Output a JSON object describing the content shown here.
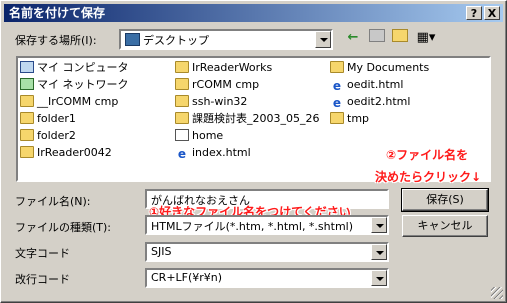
{
  "window": {
    "title": "名前を付けて保存",
    "help_label": "?",
    "close_label": "X"
  },
  "location": {
    "label": "保存する場所(I):",
    "value": "デスクトップ"
  },
  "toolbar": {
    "back_icon": "←",
    "view_icon": "▦▾"
  },
  "files": [
    {
      "name": "マイ コンピュータ",
      "icon": "pc"
    },
    {
      "name": "マイ ネットワーク",
      "icon": "net"
    },
    {
      "name": "__IrCOMM cmp",
      "icon": "folder"
    },
    {
      "name": "folder1",
      "icon": "folder"
    },
    {
      "name": "folder2",
      "icon": "folder"
    },
    {
      "name": "IrReader0042",
      "icon": "folder"
    },
    {
      "name": "IrReaderWorks",
      "icon": "folder"
    },
    {
      "name": "rCOMM cmp",
      "icon": "folder"
    },
    {
      "name": "ssh-win32",
      "icon": "folder"
    },
    {
      "name": "課題検討表_2003_05_26",
      "icon": "folder"
    },
    {
      "name": "home",
      "icon": "html"
    },
    {
      "name": "index.html",
      "icon": "ie"
    },
    {
      "name": "My Documents",
      "icon": "folder"
    },
    {
      "name": "oedit.html",
      "icon": "ie"
    },
    {
      "name": "oedit2.html",
      "icon": "ie"
    },
    {
      "name": "tmp",
      "icon": "folder"
    }
  ],
  "filename": {
    "label": "ファイル名(N):",
    "value": "がんばれなおえさん"
  },
  "filetype": {
    "label": "ファイルの種類(T):",
    "value": "HTMLファイル(*.htm, *.html, *.shtml)"
  },
  "charcode": {
    "label": "文字コード",
    "value": "SJIS"
  },
  "newline": {
    "label": "改行コード",
    "value": "CR+LF(¥r¥n)"
  },
  "buttons": {
    "save": "保存(S)",
    "cancel": "キャンセル"
  },
  "annotations": {
    "note1": "①好きなファイル名をつけてください",
    "note2_line1": "②ファイル名を",
    "note2_line2": "決めたらクリック↓"
  },
  "colors": {
    "titlebar_start": "#0a246a",
    "annotation": "#ff1a1a"
  }
}
